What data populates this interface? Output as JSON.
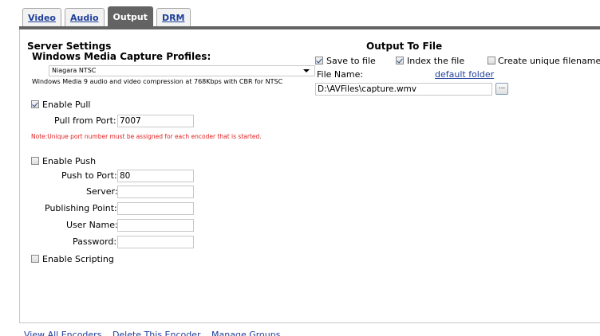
{
  "tabs": [
    {
      "label": "Video",
      "active": false
    },
    {
      "label": "Audio",
      "active": false
    },
    {
      "label": "Output",
      "active": true
    },
    {
      "label": "DRM",
      "active": false
    }
  ],
  "server": {
    "heading": "Server Settings",
    "profiles_label": "Windows Media Capture Profiles:",
    "profile_selected": "Niagara NTSC",
    "profile_desc": "Windows Media 9 audio and video compression at 768Kbps with CBR for NTSC",
    "enable_pull_label": "Enable Pull",
    "enable_pull_checked": true,
    "pull_port_label": "Pull from Port:",
    "pull_port_value": "7007",
    "note": "Note:Unique port number must be assigned for each encoder that is started.",
    "enable_push_label": "Enable Push",
    "enable_push_checked": false,
    "push_port_label": "Push to Port:",
    "push_port_value": "80",
    "server_label": "Server:",
    "server_value": "",
    "publishing_point_label": "Publishing Point:",
    "publishing_point_value": "",
    "user_name_label": "User Name:",
    "user_name_value": "",
    "password_label": "Password:",
    "password_value": "",
    "enable_scripting_label": "Enable Scripting",
    "enable_scripting_checked": false
  },
  "output_file": {
    "heading": "Output To File",
    "save_to_file_label": "Save to file",
    "save_to_file_checked": true,
    "index_file_label": "Index the file",
    "index_file_checked": true,
    "unique_filename_label": "Create unique filename",
    "unique_filename_checked": false,
    "file_name_label": "File Name:",
    "default_folder_link": "default folder",
    "file_path_value": "D:\\AVFiles\\capture.wmv",
    "browse_label": "..."
  },
  "footer": {
    "links": [
      "View All Encoders",
      "Delete This Encoder",
      "Manage Groups"
    ]
  },
  "colors": {
    "tab_active_bg": "#636363",
    "link": "#1f3f9a",
    "note_text": "#e02020"
  }
}
